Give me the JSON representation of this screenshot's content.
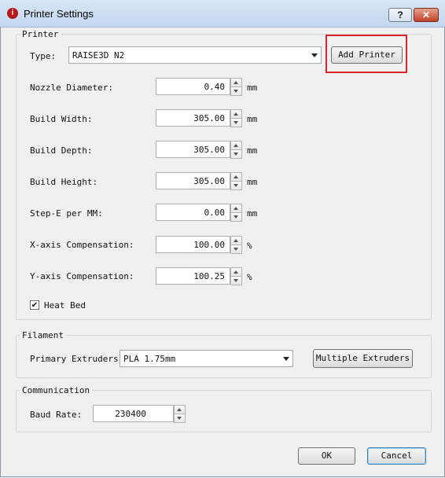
{
  "window": {
    "title": "Printer Settings",
    "help_label": "?",
    "close_label": "✕"
  },
  "printer": {
    "group_label": "Printer",
    "type_label": "Type:",
    "type_value": "RAISE3D N2",
    "add_printer_label": "Add Printer",
    "fields": [
      {
        "label": "Nozzle Diameter:",
        "value": "0.40",
        "unit": "mm"
      },
      {
        "label": "Build Width:",
        "value": "305.00",
        "unit": "mm"
      },
      {
        "label": "Build Depth:",
        "value": "305.00",
        "unit": "mm"
      },
      {
        "label": "Build Height:",
        "value": "305.00",
        "unit": "mm"
      },
      {
        "label": "Step-E per MM:",
        "value": "0.00",
        "unit": "mm"
      },
      {
        "label": "X-axis Compensation:",
        "value": "100.00",
        "unit": "%"
      },
      {
        "label": "Y-axis Compensation:",
        "value": "100.25",
        "unit": "%"
      }
    ],
    "heat_bed_label": "Heat Bed",
    "heat_bed_checked": true
  },
  "filament": {
    "group_label": "Filament",
    "primary_label": "Primary Extruders:",
    "primary_value": "PLA 1.75mm",
    "multiple_label": "Multiple Extruders"
  },
  "communication": {
    "group_label": "Communication",
    "baud_label": "Baud Rate:",
    "baud_value": "230400"
  },
  "footer": {
    "ok_label": "OK",
    "cancel_label": "Cancel"
  },
  "colors": {
    "highlight": "#d9262b",
    "titlebar": "#c9dcf1"
  }
}
